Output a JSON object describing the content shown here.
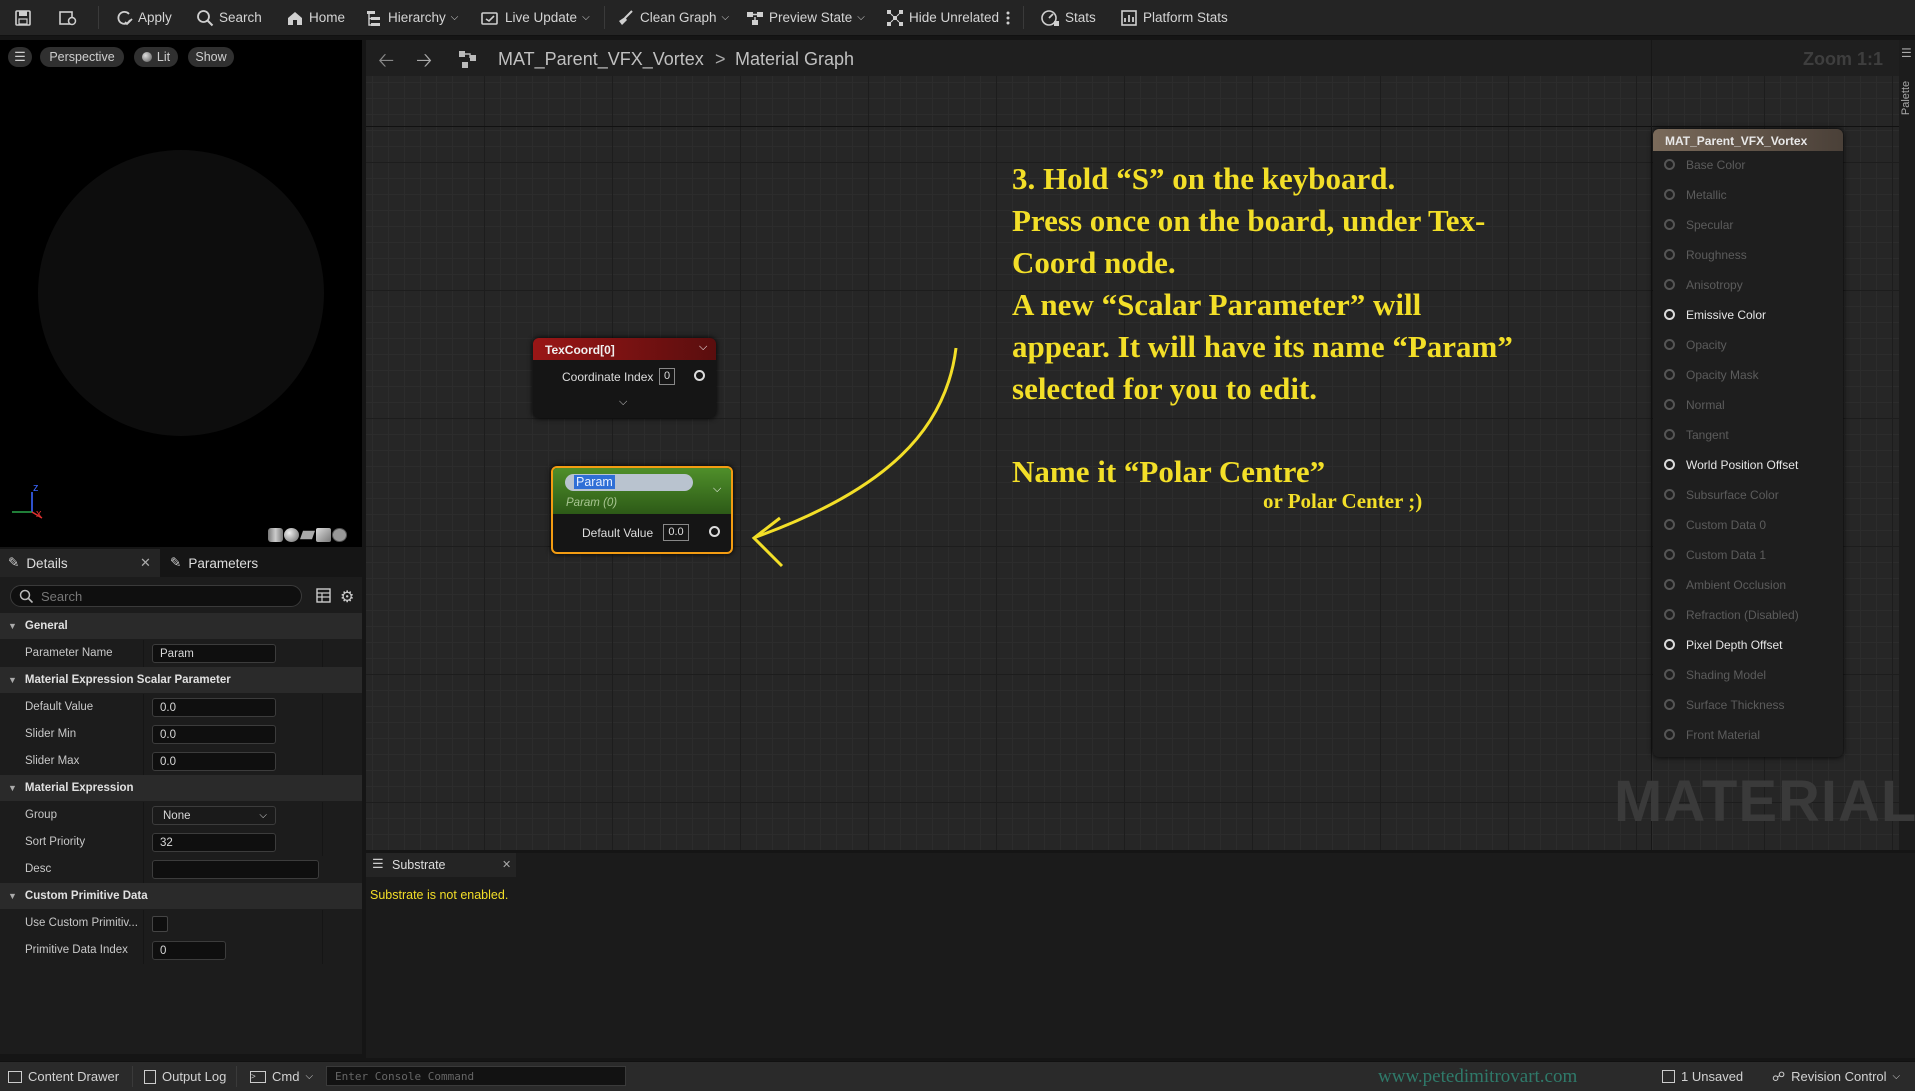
{
  "toolbar": {
    "apply": "Apply",
    "search": "Search",
    "home": "Home",
    "hierarchy": "Hierarchy",
    "live_update": "Live Update",
    "clean_graph": "Clean Graph",
    "preview_state": "Preview State",
    "hide_unrelated": "Hide Unrelated",
    "stats": "Stats",
    "platform_stats": "Platform Stats"
  },
  "viewport": {
    "perspective": "Perspective",
    "lit": "Lit",
    "show": "Show",
    "axis_z": "z",
    "axis_x": "x"
  },
  "details": {
    "tab_details": "Details",
    "tab_parameters": "Parameters",
    "search_placeholder": "Search",
    "sections": {
      "general": "General",
      "scalar": "Material Expression Scalar Parameter",
      "expression": "Material Expression",
      "custom": "Custom Primitive Data"
    },
    "rows": {
      "parameter_name_label": "Parameter Name",
      "parameter_name_value": "Param",
      "default_value_label": "Default Value",
      "default_value_value": "0.0",
      "slider_min_label": "Slider Min",
      "slider_min_value": "0.0",
      "slider_max_label": "Slider Max",
      "slider_max_value": "0.0",
      "group_label": "Group",
      "group_value": "None",
      "sort_priority_label": "Sort Priority",
      "sort_priority_value": "32",
      "desc_label": "Desc",
      "desc_value": "",
      "use_custom_label": "Use Custom Primitiv...",
      "primitive_index_label": "Primitive Data Index",
      "primitive_index_value": "0"
    }
  },
  "graph": {
    "asset_name": "MAT_Parent_VFX_Vortex",
    "crumb_separator": ">",
    "graph_name": "Material Graph",
    "zoom": "Zoom 1:1",
    "palette": "Palette",
    "watermark": "MATERIAL",
    "texcoord_node": {
      "title": "TexCoord[0]",
      "pin_label": "Coordinate Index",
      "pin_value": "0"
    },
    "param_node": {
      "name": "Param",
      "subtitle": "Param (0)",
      "pin_label": "Default Value",
      "pin_value": "0.0"
    },
    "result_node": {
      "title": "MAT_Parent_VFX_Vortex",
      "pins": [
        {
          "label": "Base Color",
          "enabled": false
        },
        {
          "label": "Metallic",
          "enabled": false
        },
        {
          "label": "Specular",
          "enabled": false
        },
        {
          "label": "Roughness",
          "enabled": false
        },
        {
          "label": "Anisotropy",
          "enabled": false
        },
        {
          "label": "Emissive Color",
          "enabled": true
        },
        {
          "label": "Opacity",
          "enabled": false
        },
        {
          "label": "Opacity Mask",
          "enabled": false
        },
        {
          "label": "Normal",
          "enabled": false
        },
        {
          "label": "Tangent",
          "enabled": false
        },
        {
          "label": "World Position Offset",
          "enabled": true
        },
        {
          "label": "Subsurface Color",
          "enabled": false
        },
        {
          "label": "Custom Data 0",
          "enabled": false
        },
        {
          "label": "Custom Data 1",
          "enabled": false
        },
        {
          "label": "Ambient Occlusion",
          "enabled": false
        },
        {
          "label": "Refraction (Disabled)",
          "enabled": false
        },
        {
          "label": "Pixel Depth Offset",
          "enabled": true
        },
        {
          "label": "Shading Model",
          "enabled": false
        },
        {
          "label": "Surface Thickness",
          "enabled": false
        },
        {
          "label": "Front Material",
          "enabled": false
        }
      ]
    },
    "annotation": {
      "lines": [
        "3. Hold “S” on the keyboard.",
        "Press once on the board, under Tex-",
        "Coord node.",
        "A new “Scalar Parameter” will",
        "appear. It will have its name “Param”",
        "selected for you to edit."
      ],
      "name_line": "Name it “Polar Centre”",
      "alt_line": "or Polar Center ;)",
      "color": "#f3df28"
    }
  },
  "substrate": {
    "tab": "Substrate",
    "message": "Substrate is not enabled."
  },
  "bottom": {
    "content_drawer": "Content Drawer",
    "output_log": "Output Log",
    "cmd": "Cmd",
    "console_placeholder": "Enter Console Command",
    "website": "www.petedimitrovart.com",
    "unsaved": "1 Unsaved",
    "revision_control": "Revision Control"
  }
}
